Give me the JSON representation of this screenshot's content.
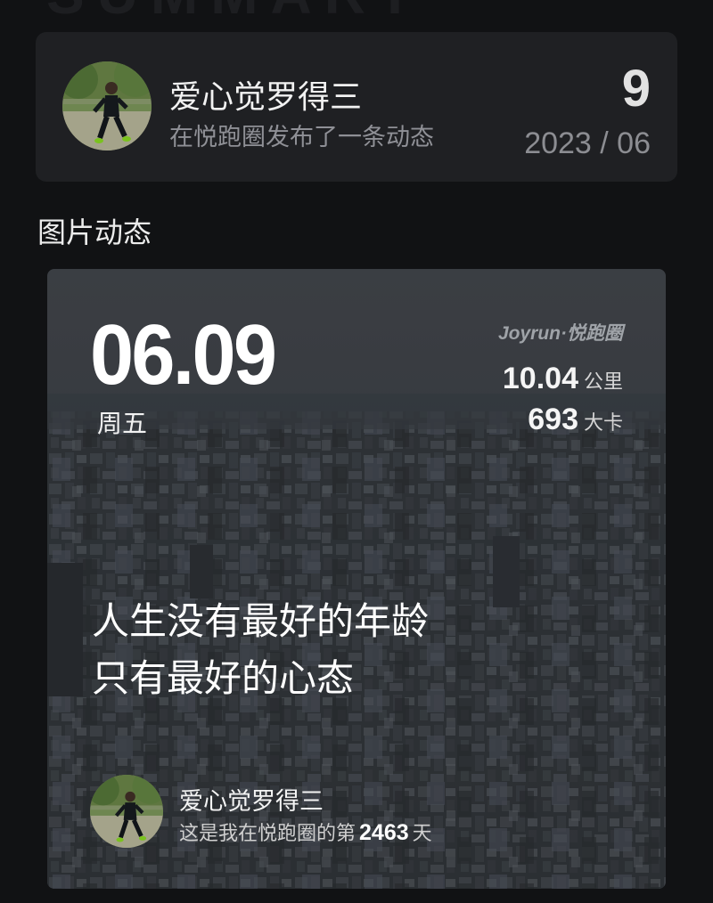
{
  "header": {
    "username": "爱心觉罗得三",
    "subtitle": "在悦跑圈发布了一条动态",
    "day": "9",
    "year_month": "2023 / 06"
  },
  "section": {
    "label": "图片动态"
  },
  "post": {
    "date": "06.09",
    "weekday": "周五",
    "brand": "Joyrun·悦跑圈",
    "distance": {
      "value": "10.04",
      "unit": "公里"
    },
    "calories": {
      "value": "693",
      "unit": "大卡"
    },
    "slogan_line1": "人生没有最好的年龄",
    "slogan_line2": "只有最好的心态",
    "footer": {
      "username": "爱心觉罗得三",
      "prefix": "这是我在悦跑圈的第",
      "days": "2463",
      "suffix": "天"
    }
  },
  "ghost_title": "SUMMARY",
  "colors": {
    "background": "#111214",
    "card": "#1f2023",
    "muted_text": "#8f9096"
  },
  "icons": {
    "avatar": "runner-photo",
    "post_background": "city-aerial-photo"
  }
}
